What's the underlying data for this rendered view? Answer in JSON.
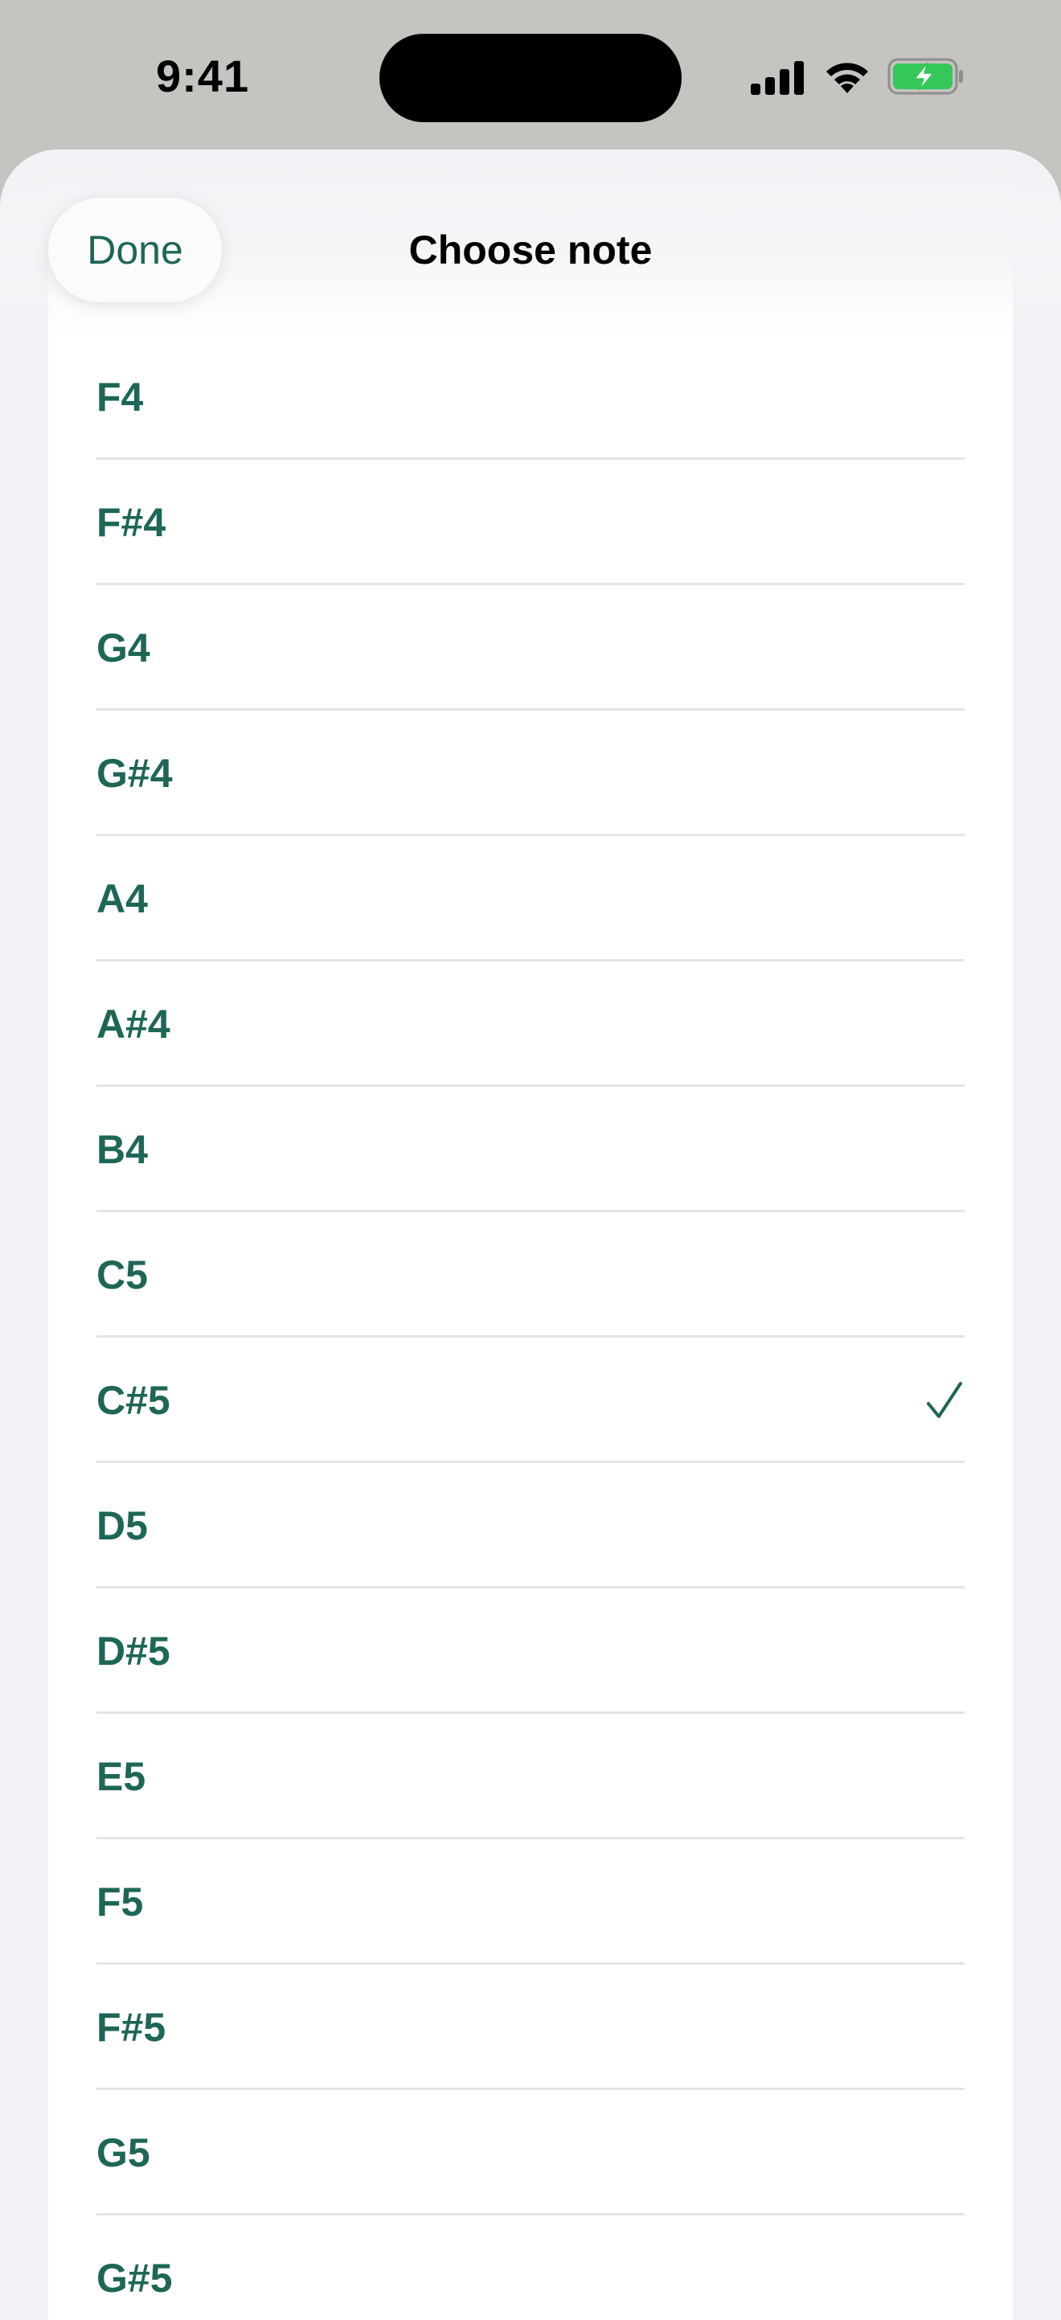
{
  "status_bar": {
    "time": "9:41",
    "icons": [
      "cellular-signal-icon",
      "wifi-icon",
      "battery-charging-icon"
    ],
    "battery_color": "#34c759"
  },
  "sheet": {
    "title": "Choose note",
    "done_label": "Done"
  },
  "colors": {
    "accent": "#1e6657",
    "sheet_background": "#f2f2f6",
    "row_background": "#ffffff",
    "divider": "#e4e4e8"
  },
  "notes": [
    {
      "label": "F4",
      "selected": false
    },
    {
      "label": "F#4",
      "selected": false
    },
    {
      "label": "G4",
      "selected": false
    },
    {
      "label": "G#4",
      "selected": false
    },
    {
      "label": "A4",
      "selected": false
    },
    {
      "label": "A#4",
      "selected": false
    },
    {
      "label": "B4",
      "selected": false
    },
    {
      "label": "C5",
      "selected": false
    },
    {
      "label": "C#5",
      "selected": true
    },
    {
      "label": "D5",
      "selected": false
    },
    {
      "label": "D#5",
      "selected": false
    },
    {
      "label": "E5",
      "selected": false
    },
    {
      "label": "F5",
      "selected": false
    },
    {
      "label": "F#5",
      "selected": false
    },
    {
      "label": "G5",
      "selected": false
    },
    {
      "label": "G#5",
      "selected": false
    }
  ]
}
